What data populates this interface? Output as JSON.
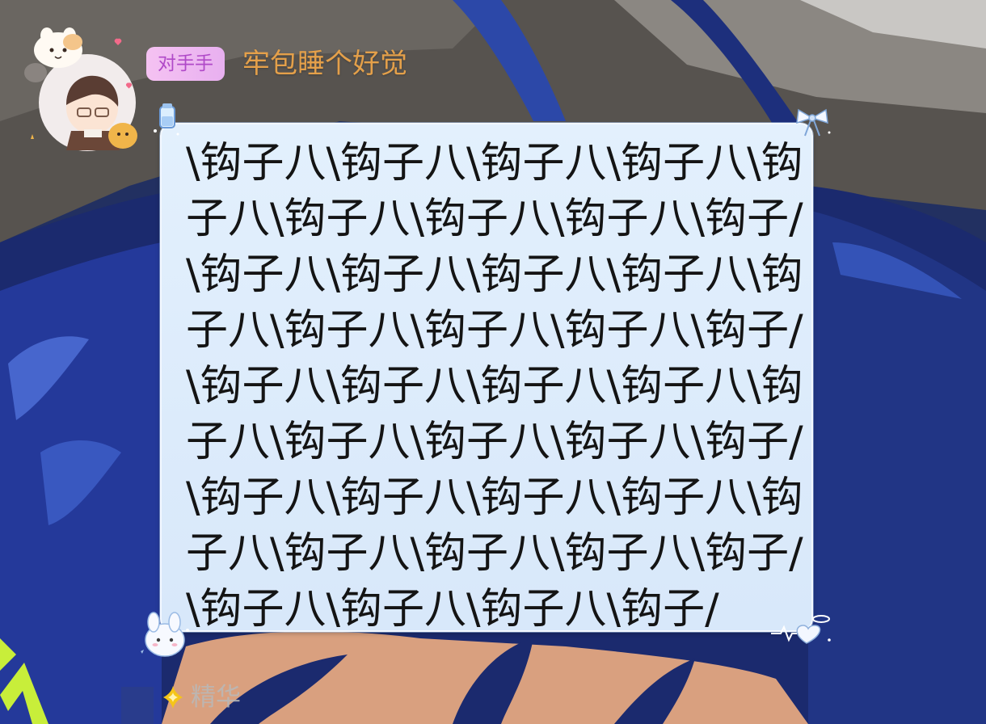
{
  "header": {
    "role_badge": "对手手",
    "nickname": "牢包睡个好觉"
  },
  "message": {
    "lines": [
      "\\钩子八\\钩子八\\钩子八\\钩子八\\钩",
      "子八\\钩子八\\钩子八\\钩子八\\钩子/",
      "\\钩子八\\钩子八\\钩子八\\钩子八\\钩",
      "子八\\钩子八\\钩子八\\钩子八\\钩子/",
      "\\钩子八\\钩子八\\钩子八\\钩子八\\钩",
      "子八\\钩子八\\钩子八\\钩子八\\钩子/",
      "\\钩子八\\钩子八\\钩子八\\钩子八\\钩",
      "子八\\钩子八\\钩子八\\钩子八\\钩子/",
      "\\钩子八\\钩子八\\钩子八\\钩子/"
    ]
  },
  "footer": {
    "essence_label": "精华"
  },
  "colors": {
    "badge_bg": "#f5c2f2",
    "badge_text": "#b049c8",
    "nickname": "#e4a04a",
    "bubble_bg": "#e3f0fd",
    "message_text": "#141414",
    "essence_icon": "#f5c518",
    "essence_text": "#b9b9b9"
  },
  "icons": {
    "avatar": "avatar",
    "bubble_top_left": "bottle-deco-icon",
    "bubble_top_right": "ribbon-bow-icon",
    "bubble_bottom_left": "bunny-deco-icon",
    "bubble_bottom_right": "heart-halo-icon",
    "essence": "essence-diamond-icon"
  }
}
